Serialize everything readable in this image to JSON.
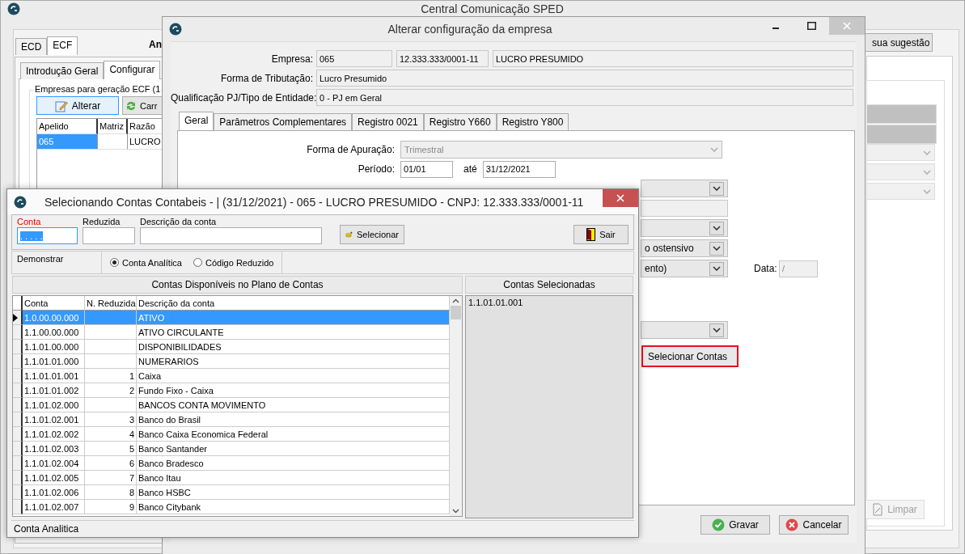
{
  "main_window": {
    "title": "Central Comunicação SPED",
    "tabs": [
      {
        "label": "ECD",
        "selected": false
      },
      {
        "label": "ECF",
        "selected": true
      }
    ],
    "heading": "An",
    "subtabs": [
      {
        "label": "Introdução Geral",
        "selected": false
      },
      {
        "label": "Configurar",
        "selected": true
      }
    ],
    "group_title": "Empresas para geração ECF (1",
    "edit_button": "Alterar",
    "load_button": "Carr",
    "grid": {
      "columns": [
        "Apelido",
        "Matriz",
        "Razão"
      ],
      "rows": [
        {
          "apelido": "065",
          "razao": "LUCRO",
          "selected": true
        }
      ]
    },
    "suggestion_button": "sua sugestão",
    "clear_button": {
      "label": "Limpar",
      "disabled": true
    }
  },
  "config_dialog": {
    "title": "Alterar configuração da empresa",
    "empresa_label": "Empresa:",
    "empresa_code": "065",
    "cnpj": "12.333.333/0001-11",
    "empresa_name": "LUCRO PRESUMIDO",
    "tributacao_label": "Forma de Tributação:",
    "tributacao": "Lucro Presumido",
    "qualificacao_label": "Qualificação PJ/Tipo de Entidade:",
    "qualificacao": "0 - PJ em Geral",
    "tabs": [
      {
        "label": "Geral",
        "selected": true
      },
      {
        "label": "Parâmetros Complementares",
        "selected": false
      },
      {
        "label": "Registro 0021",
        "selected": false
      },
      {
        "label": "Registro Y660",
        "selected": false
      },
      {
        "label": "Registro Y800",
        "selected": false
      }
    ],
    "apuracao_label": "Forma de Apuração:",
    "apuracao": "Trimestral",
    "periodo_label": "Período:",
    "periodo_inicio": "01/01",
    "ate_label": "até",
    "periodo_fim": "31/12/2021",
    "partial_fields": [
      {
        "kind": "select"
      },
      {
        "kind": "field"
      },
      {
        "kind": "select"
      },
      {
        "kind": "select",
        "value": "o ostensivo"
      },
      {
        "kind": "select",
        "value": "ento)"
      }
    ],
    "data_label": "Data:",
    "data_value": "/",
    "select_accounts_button": "Selecionar Contas",
    "save_button": "Gravar",
    "cancel_button": "Cancelar"
  },
  "accounts_dialog": {
    "title": "Selecionando Contas Contabeis - | (31/12/2021) - 065 - LUCRO PRESUMIDO  - CNPJ: 12.333.333/0001-11",
    "conta_label": "Conta",
    "conta_value": ". . . . .",
    "reduzida_label": "Reduzida",
    "descricao_label": "Descrição da conta",
    "select_button": "Selecionar",
    "exit_button": "Sair",
    "show_label": "Demonstrar",
    "options": [
      {
        "label": "Conta Analítica",
        "selected": true
      },
      {
        "label": "Código Reduzido",
        "selected": false
      }
    ],
    "available_header": "Contas Disponíveis no Plano de Contas",
    "selected_header": "Contas Selecionadas",
    "columns": [
      "Conta",
      "N. Reduzida",
      "Descrição da conta"
    ],
    "rows": [
      {
        "conta": "1.0.00.00.000",
        "descricao": "ATIVO",
        "selected": true
      },
      {
        "conta": "1.1.00.00.000",
        "descricao": "ATIVO CIRCULANTE",
        "selected": false
      },
      {
        "conta": "1.1.01.00.000",
        "descricao": "DISPONIBILIDADES",
        "selected": false
      },
      {
        "conta": "1.1.01.01.000",
        "descricao": "NUMERARIOS",
        "selected": false
      },
      {
        "conta": "1.1.01.01.001",
        "reduzida": "1",
        "descricao": "Caixa",
        "selected": false
      },
      {
        "conta": "1.1.01.01.002",
        "reduzida": "2",
        "descricao": "Fundo Fixo - Caixa",
        "selected": false
      },
      {
        "conta": "1.1.01.02.000",
        "descricao": "BANCOS CONTA MOVIMENTO",
        "selected": false
      },
      {
        "conta": "1.1.01.02.001",
        "reduzida": "3",
        "descricao": "Banco do Brasil",
        "selected": false
      },
      {
        "conta": "1.1.01.02.002",
        "reduzida": "4",
        "descricao": "Banco Caixa Economica Federal",
        "selected": false
      },
      {
        "conta": "1.1.01.02.003",
        "reduzida": "5",
        "descricao": "Banco Santander",
        "selected": false
      },
      {
        "conta": "1.1.01.02.004",
        "reduzida": "6",
        "descricao": "Banco Bradesco",
        "selected": false
      },
      {
        "conta": "1.1.01.02.005",
        "reduzida": "7",
        "descricao": "Banco Itau",
        "selected": false
      },
      {
        "conta": "1.1.01.02.006",
        "reduzida": "8",
        "descricao": "Banco HSBC",
        "selected": false
      },
      {
        "conta": "1.1.01.02.007",
        "reduzida": "9",
        "descricao": "Banco Citybank",
        "selected": false
      }
    ],
    "selected_accounts": [
      "1.1.01.01.001"
    ],
    "status": "Conta Analitica"
  }
}
